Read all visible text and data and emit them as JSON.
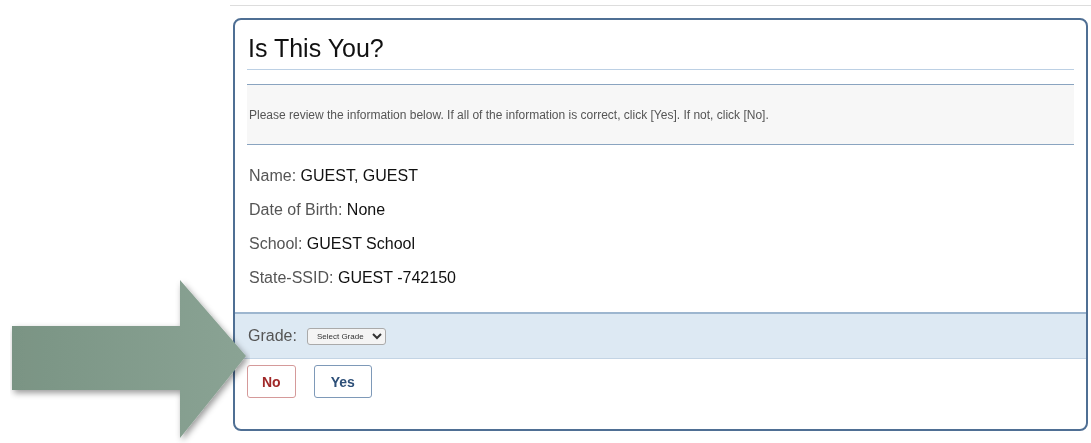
{
  "dialog": {
    "title": "Is This You?",
    "instructions": "Please review the information below. If all of the information is correct, click [Yes]. If not, click [No].",
    "fields": [
      {
        "label": "Name:",
        "value": "GUEST, GUEST"
      },
      {
        "label": "Date of Birth:",
        "value": "None"
      },
      {
        "label": "School:",
        "value": "GUEST School"
      },
      {
        "label": "State-SSID:",
        "value": "GUEST -742150"
      }
    ],
    "grade": {
      "label": "Grade:",
      "select": "Select Grade"
    },
    "buttons": [
      {
        "label": "No",
        "kind": "danger"
      },
      {
        "label": "Yes",
        "kind": "primary"
      }
    ]
  }
}
